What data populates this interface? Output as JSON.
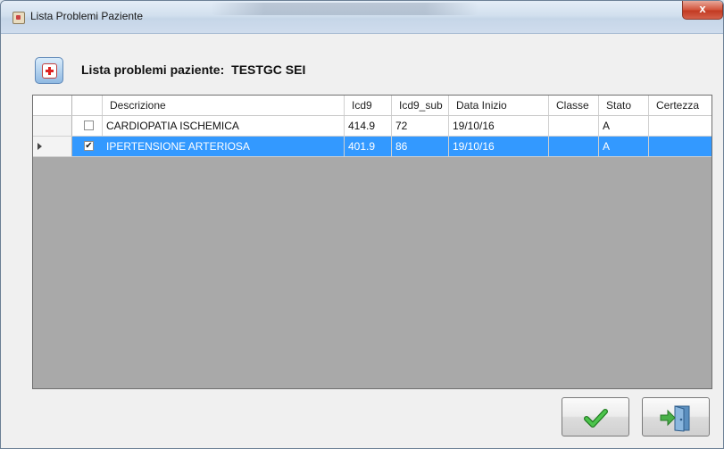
{
  "window": {
    "title": "Lista Problemi Paziente",
    "close_label": "x"
  },
  "header": {
    "label": "Lista problemi paziente:",
    "patient": "TESTGC SEI"
  },
  "grid": {
    "columns": [
      "Descrizione",
      "Icd9",
      "Icd9_sub",
      "Data Inizio",
      "Classe",
      "Stato",
      "Certezza"
    ],
    "rows": [
      {
        "checked": false,
        "selected": false,
        "descrizione": "CARDIOPATIA ISCHEMICA",
        "icd9": "414.9",
        "icd9_sub": "72",
        "data_inizio": "19/10/16",
        "classe": "",
        "stato": "A",
        "certezza": ""
      },
      {
        "checked": true,
        "selected": true,
        "descrizione": "IPERTENSIONE ARTERIOSA",
        "icd9": "401.9",
        "icd9_sub": "86",
        "data_inizio": "19/10/16",
        "classe": "",
        "stato": "A",
        "certezza": ""
      }
    ]
  },
  "buttons": {
    "ok_icon": "checkmark-icon",
    "exit_icon": "exit-door-icon"
  },
  "colors": {
    "selection": "#3399ff",
    "grid_empty": "#a9a9a9",
    "ok_green": "#3aa53a"
  }
}
